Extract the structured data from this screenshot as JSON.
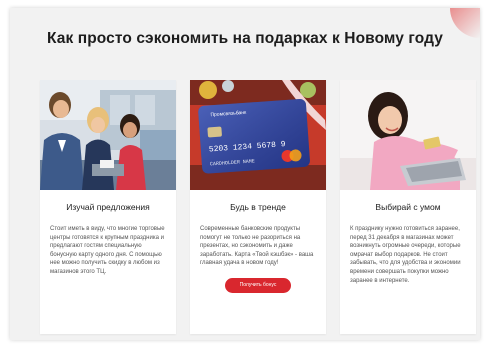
{
  "page": {
    "title": "Как просто сэкономить на подарках к Новому году"
  },
  "cards": [
    {
      "title": "Изучай предложения",
      "text": "Стоит иметь в виду, что многие торговые центры готовятся к крупным праздника и предлагают гостям специальную бонусную карту одного дня. С помощью нее можно получить скидку в любом из магазинов этого ТЦ."
    },
    {
      "title": "Будь в тренде",
      "text": "Современные банковские продукты помогут не только не разориться на презентах, но сэкономить и даже заработать. Карта «Твой кэшбэк» - ваша главная удача в новом году!",
      "button_label": "Получить бонус",
      "card_image": {
        "bank_name": "Промсвязьбанк",
        "number": "5203 1234 5678 9",
        "holder": "CARDHOLDER NAME"
      }
    },
    {
      "title": "Выбирай с умом",
      "text": "К празднику нужно готовиться заранее, перед 31 декабря в магазинах может возникнуть огромные очереди, которые омрачат выбор подарков. Не стоит забывать, что для удобства и экономии времени совершать покупки можно заранее в интернете."
    }
  ],
  "colors": {
    "accent": "#d9272e",
    "page_background": "#f2f2f2",
    "card_background": "#ffffff"
  }
}
